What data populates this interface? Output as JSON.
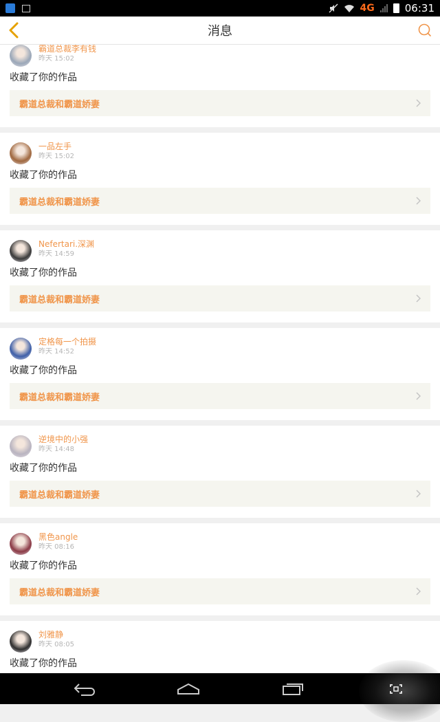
{
  "status_bar": {
    "network": "4G",
    "time": "06:31"
  },
  "header": {
    "title": "消息"
  },
  "messages": [
    {
      "user": "霸道总裁李有钱",
      "time": "昨天 15:02",
      "action": "收藏了你的作品",
      "work": "霸道总裁和霸道娇妻",
      "avatar_color": "#9aa7b8"
    },
    {
      "user": "一品左手",
      "time": "昨天 15:02",
      "action": "收藏了你的作品",
      "work": "霸道总裁和霸道娇妻",
      "avatar_color": "#a0683f"
    },
    {
      "user": "Nefertari.深渊",
      "time": "昨天 14:59",
      "action": "收藏了你的作品",
      "work": "霸道总裁和霸道娇妻",
      "avatar_color": "#3a3a3a"
    },
    {
      "user": "定格每一个拍摄",
      "time": "昨天 14:52",
      "action": "收藏了你的作品",
      "work": "霸道总裁和霸道娇妻",
      "avatar_color": "#3e5fa8"
    },
    {
      "user": "逆境中的小强",
      "time": "昨天 14:48",
      "action": "收藏了你的作品",
      "work": "霸道总裁和霸道娇妻",
      "avatar_color": "#b9b4c0"
    },
    {
      "user": "黑色angle",
      "time": "昨天 08:16",
      "action": "收藏了你的作品",
      "work": "霸道总裁和霸道娇妻",
      "avatar_color": "#8b3a46"
    },
    {
      "user": "刘雅静",
      "time": "昨天 08:05",
      "action": "收藏了你的作品",
      "work": "霸道总裁和霸道娇妻",
      "avatar_color": "#2f2f2f"
    }
  ],
  "colors": {
    "accent": "#f0954a",
    "back_icon": "#e6a100",
    "search_icon": "#f0954a"
  },
  "icons": {
    "back": "chevron-left-icon",
    "search": "search-icon",
    "nav_back": "back-arrow-icon",
    "nav_home": "home-icon",
    "nav_recent": "recent-apps-icon",
    "nav_extra": "screen-expand-icon"
  }
}
